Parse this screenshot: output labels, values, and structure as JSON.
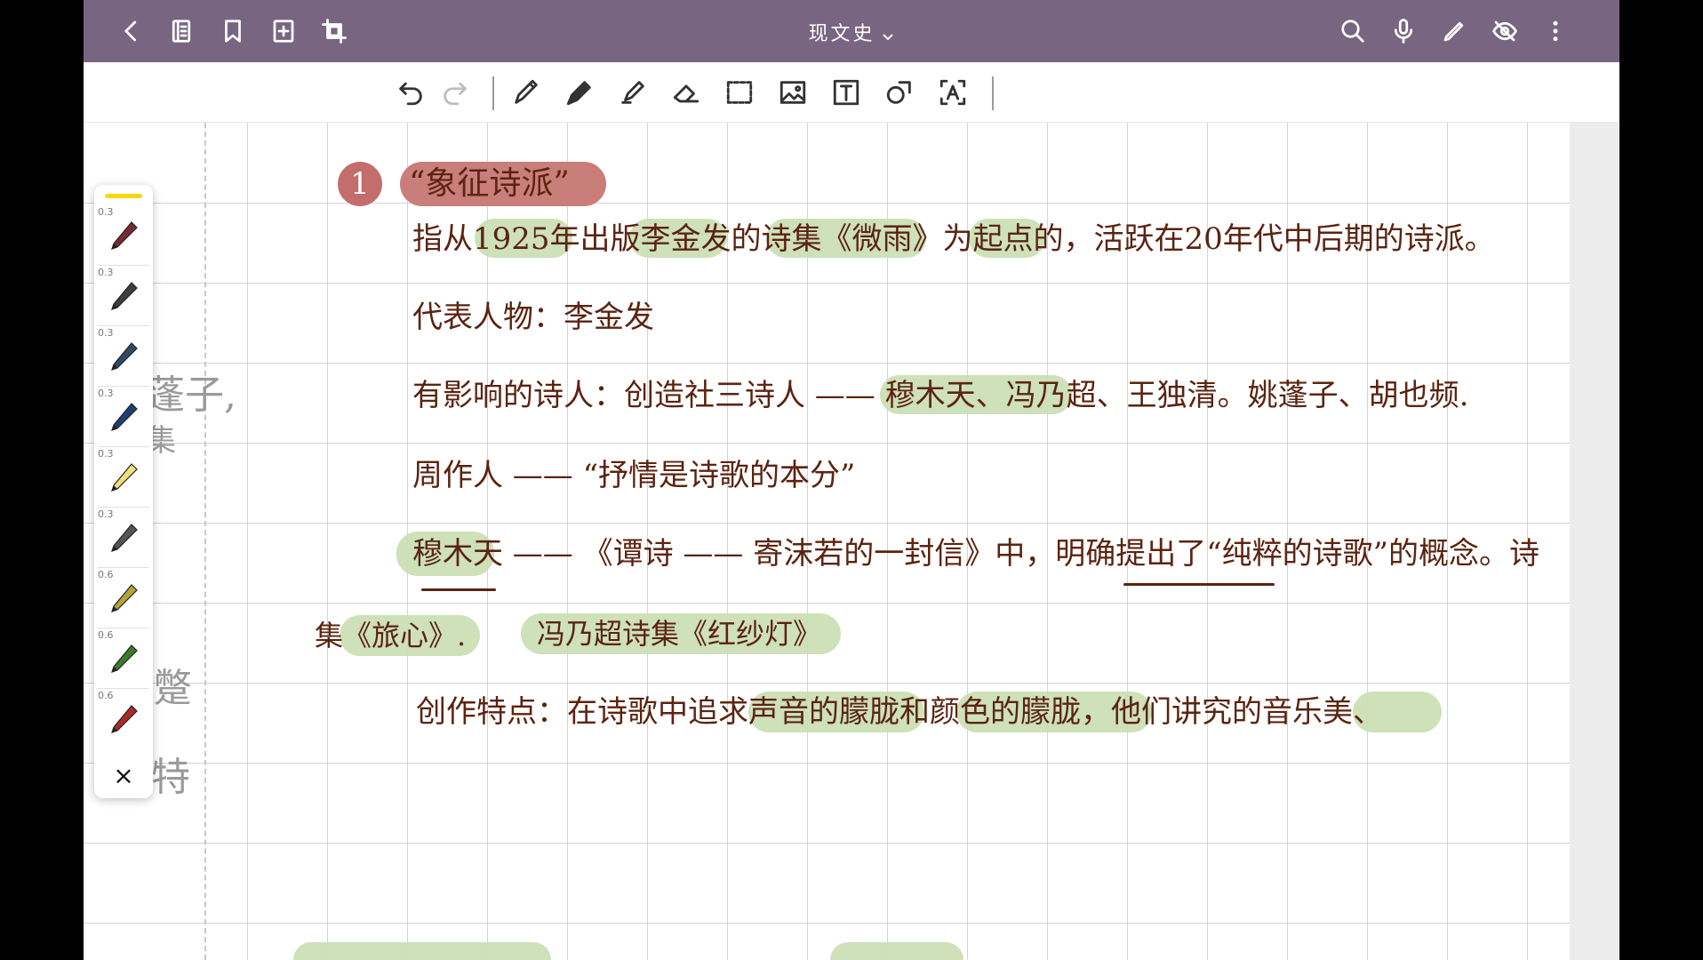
{
  "header": {
    "title": "现文史",
    "left_icons": [
      "back-icon",
      "outline-icon",
      "bookmark-icon",
      "add-page-icon",
      "crop-icon"
    ],
    "right_icons": [
      "search-icon",
      "microphone-icon",
      "pen-icon",
      "hide-icon",
      "more-icon"
    ]
  },
  "toolbar": {
    "tools": [
      "undo",
      "redo",
      "pencil",
      "pen",
      "highlighter",
      "eraser",
      "lasso-select",
      "image",
      "text",
      "shape",
      "text-recognition"
    ]
  },
  "palette": {
    "pens": [
      {
        "size": "0.3",
        "color": "#7a2a33"
      },
      {
        "size": "0.3",
        "color": "#3e3e3e"
      },
      {
        "size": "0.3",
        "color": "#2e4a63"
      },
      {
        "size": "0.3",
        "color": "#1f3f73"
      },
      {
        "size": "0.3",
        "color": "#f1e07a"
      },
      {
        "size": "0.3",
        "color": "#555555"
      },
      {
        "size": "0.6",
        "color": "#b3a33a"
      },
      {
        "size": "0.6",
        "color": "#3f7a2b"
      },
      {
        "size": "0.6",
        "color": "#a82a2a"
      }
    ],
    "close_label": "×"
  },
  "notes": {
    "number": "1",
    "title": "“象征诗派”",
    "line1": "指从1925年出版李金发的诗集《微雨》为起点的，活跃在20年代中后期的诗派。",
    "line2": "代表人物：李金发",
    "line3": "有影响的诗人：创造社三诗人 —— 穆木天、冯乃超、王独清。姚蓬子、胡也频.",
    "line4": "周作人 —— “抒情是诗歌的本分”",
    "line5": "穆木天 —— 《谭诗 —— 寄沫若的一封信》中，明确提出了“纯粹的诗歌”的概念。诗",
    "line6a": "集《旅心》.",
    "line6b": "冯乃超诗集《红纱灯》",
    "line7": "创作特点：在诗歌中追求声音的朦胧和颜色的朦胧，他们讲究的音乐美、",
    "faded_left": [
      "蓬子,",
      "集",
      "蹩",
      "特"
    ]
  }
}
